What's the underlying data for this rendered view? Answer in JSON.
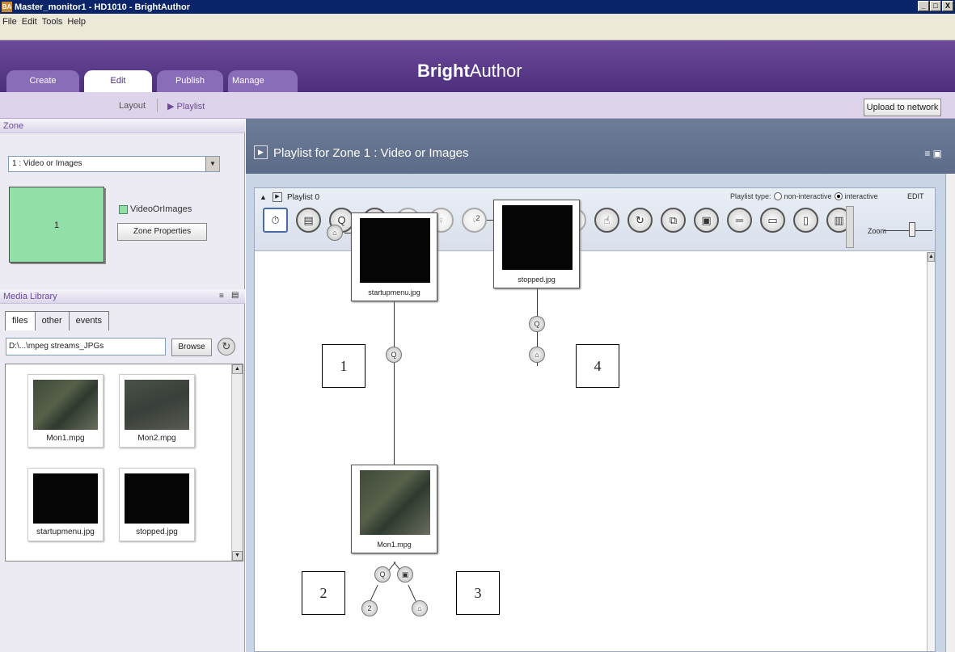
{
  "window": {
    "title": "Master_monitor1 - HD1010 - BrightAuthor",
    "app_icon": "BA",
    "min": "_",
    "max": "□",
    "close": "X"
  },
  "menu": [
    "File",
    "Edit",
    "Tools",
    "Help"
  ],
  "brand": {
    "bold": "Bright",
    "rest": "Author"
  },
  "tabs": [
    {
      "label": "Create",
      "active": false
    },
    {
      "label": "Edit",
      "active": true
    },
    {
      "label": "Publish",
      "active": false
    },
    {
      "label": "Manage",
      "active": false
    }
  ],
  "subnav": {
    "layout": "Layout",
    "playlist": "▶ Playlist",
    "upload_button": "Upload to network"
  },
  "zone_panel": {
    "title": "Zone",
    "selected_zone": "1 : Video or Images",
    "zone_number": "1",
    "legend_label": "VideoOrImages",
    "properties_button": "Zone Properties"
  },
  "media_library": {
    "title": "Media Library",
    "tabs": [
      "files",
      "other",
      "events"
    ],
    "path": "D:\\...\\mpeg streams_JPGs",
    "browse_button": "Browse",
    "files": [
      {
        "name": "Mon1.mpg",
        "kind": "aerial"
      },
      {
        "name": "Mon2.mpg",
        "kind": "aerial2"
      },
      {
        "name": "startupmenu.jpg",
        "kind": "black"
      },
      {
        "name": "stopped.jpg",
        "kind": "black"
      }
    ]
  },
  "playlist_panel": {
    "title": "Playlist for Zone 1 : Video or Images",
    "playlist_name": "Playlist 0",
    "playlist_type_label": "Playlist type:",
    "type_options": [
      "non-interactive",
      "interactive"
    ],
    "selected_type": "interactive",
    "edit_label": "EDIT",
    "zoom_label": "Zoom",
    "toolbar_icons": [
      "stopwatch-icon",
      "clapperboard-icon",
      "remote-icon",
      "remote-alt-icon",
      "gpio-0-icon",
      "gpio-3-icon",
      "gpio-4-icon",
      "gpio-5-icon",
      "gpio-6-icon",
      "gpio-7-icon",
      "touch-icon",
      "refresh-icon",
      "copy-icon",
      "monitor-icon",
      "serial-icon",
      "keyboard-icon",
      "remote-control-icon",
      "barcode-icon"
    ]
  },
  "canvas": {
    "nodes": [
      {
        "label": "startupmenu.jpg"
      },
      {
        "label": "stopped.jpg"
      },
      {
        "label": "Mon1.mpg"
      }
    ],
    "event_labels": {
      "home": "⌂",
      "remote": "Q",
      "video_end": "▣",
      "target_two": "2"
    },
    "node_prefix_two": "2",
    "callouts": [
      "1",
      "2",
      "3",
      "4"
    ]
  }
}
